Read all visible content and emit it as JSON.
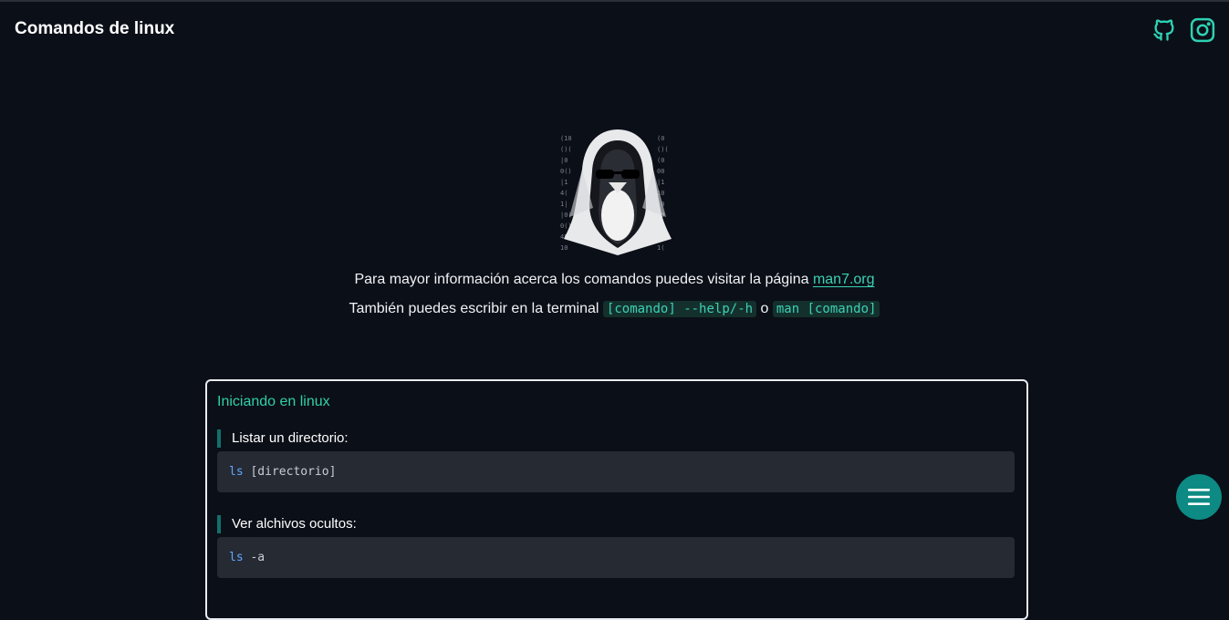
{
  "header": {
    "title": "Comandos de linux",
    "icons": [
      "github-icon",
      "instagram-icon"
    ]
  },
  "intro": {
    "line1_text": "Para mayor información acerca los comandos puedes visitar la página ",
    "line1_link": "man7.org",
    "line2_text": "También puedes escribir en la terminal ",
    "line2_code1": "[comando] --help/-h",
    "line2_or": " o ",
    "line2_code2": "man [comando]"
  },
  "section": {
    "title": "Iniciando en linux",
    "commands": [
      {
        "label": "Listar un directorio:",
        "cmd": "ls",
        "args": " [directorio]"
      },
      {
        "label": "Ver alchivos ocultos:",
        "cmd": "ls",
        "args": " -a"
      }
    ]
  },
  "colors": {
    "accent": "#3bd1b4",
    "background": "#0b0f17",
    "fab": "#0d8a84",
    "code_bg": "#262a33"
  },
  "fab": {
    "icon": "menu-icon"
  }
}
